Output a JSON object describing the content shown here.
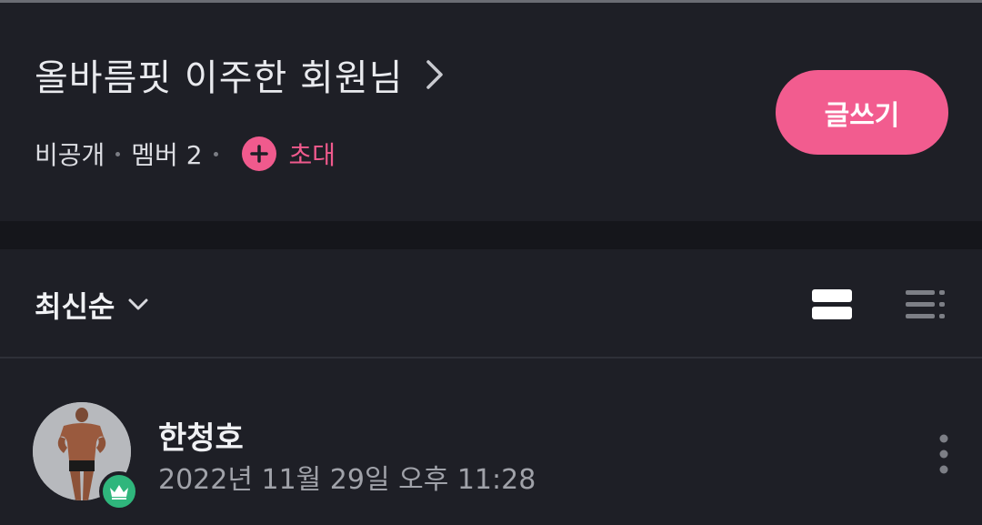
{
  "header": {
    "title": "올바름핏 이주한 회원님",
    "visibility": "비공개",
    "members_label": "멤버 2",
    "invite_label": "초대",
    "write_button_label": "글쓰기"
  },
  "sort": {
    "selected": "최신순"
  },
  "view_modes": [
    "card-view-icon",
    "list-view-icon"
  ],
  "posts": [
    {
      "author": "한청호",
      "timestamp": "2022년 11월 29일 오후 11:28",
      "badge_icon": "crown-icon"
    }
  ],
  "colors": {
    "accent": "#f25c8f",
    "badge_green": "#2fb67c",
    "background": "#1e1f26"
  }
}
